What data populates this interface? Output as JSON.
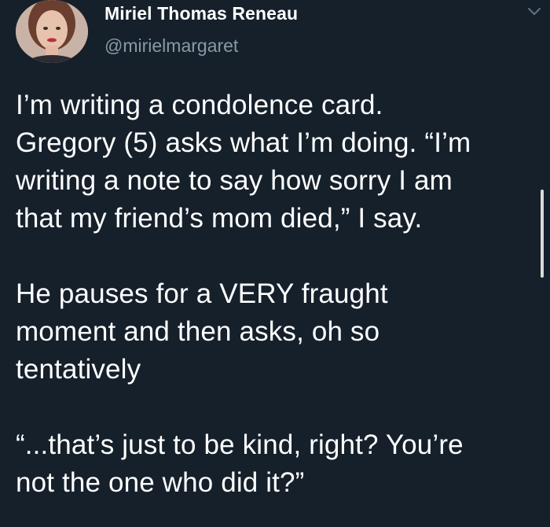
{
  "tweet": {
    "author": {
      "name": "Miriel Thomas Reneau",
      "handle": "@mirielmargaret",
      "avatar_icon": "profile-photo"
    },
    "caret_icon": "chevron-down-icon",
    "body": {
      "paragraph_1": {
        "line_1": "I’m writing a condolence card.",
        "line_2": "Gregory (5) asks what I’m doing. “I’m",
        "line_3": "writing a note to say how sorry I am",
        "line_4": "that my friend’s mom died,” I say."
      },
      "paragraph_2": {
        "line_1": "He pauses for a VERY fraught",
        "line_2": "moment and then asks, oh so",
        "line_3": "tentatively"
      },
      "paragraph_3": {
        "line_1": "“...that’s just to be kind, right? You’re",
        "line_2": "not the one who did it?”"
      }
    }
  },
  "colors": {
    "background": "#15202b",
    "text": "#ffffff",
    "secondary_text": "#8899a6"
  }
}
